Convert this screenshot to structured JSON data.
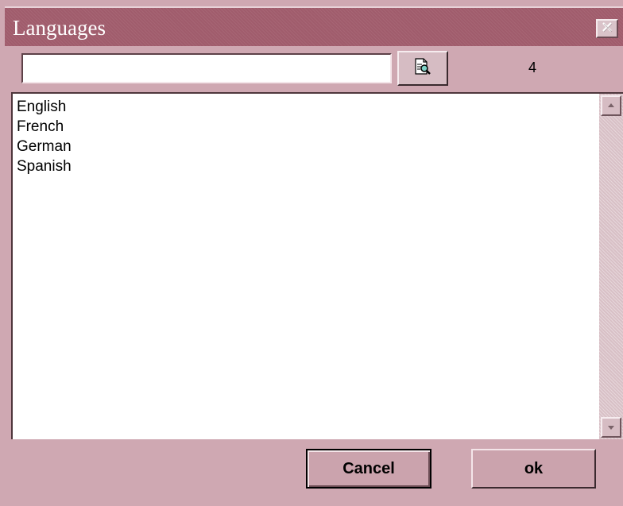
{
  "window": {
    "title": "Languages",
    "accent_color": "#a05c6c",
    "background_color": "#cfa8b2"
  },
  "titlebar": {
    "close_icon": "close-icon"
  },
  "search": {
    "value": "",
    "placeholder": "",
    "find_icon": "document-magnifier-icon"
  },
  "result_count": "4",
  "languages": [
    "English",
    "French",
    "German",
    "Spanish"
  ],
  "scrollbar": {
    "up_icon": "scroll-up-arrow-icon",
    "down_icon": "scroll-down-arrow-icon"
  },
  "buttons": {
    "cancel_label": "Cancel",
    "ok_label": "ok"
  }
}
